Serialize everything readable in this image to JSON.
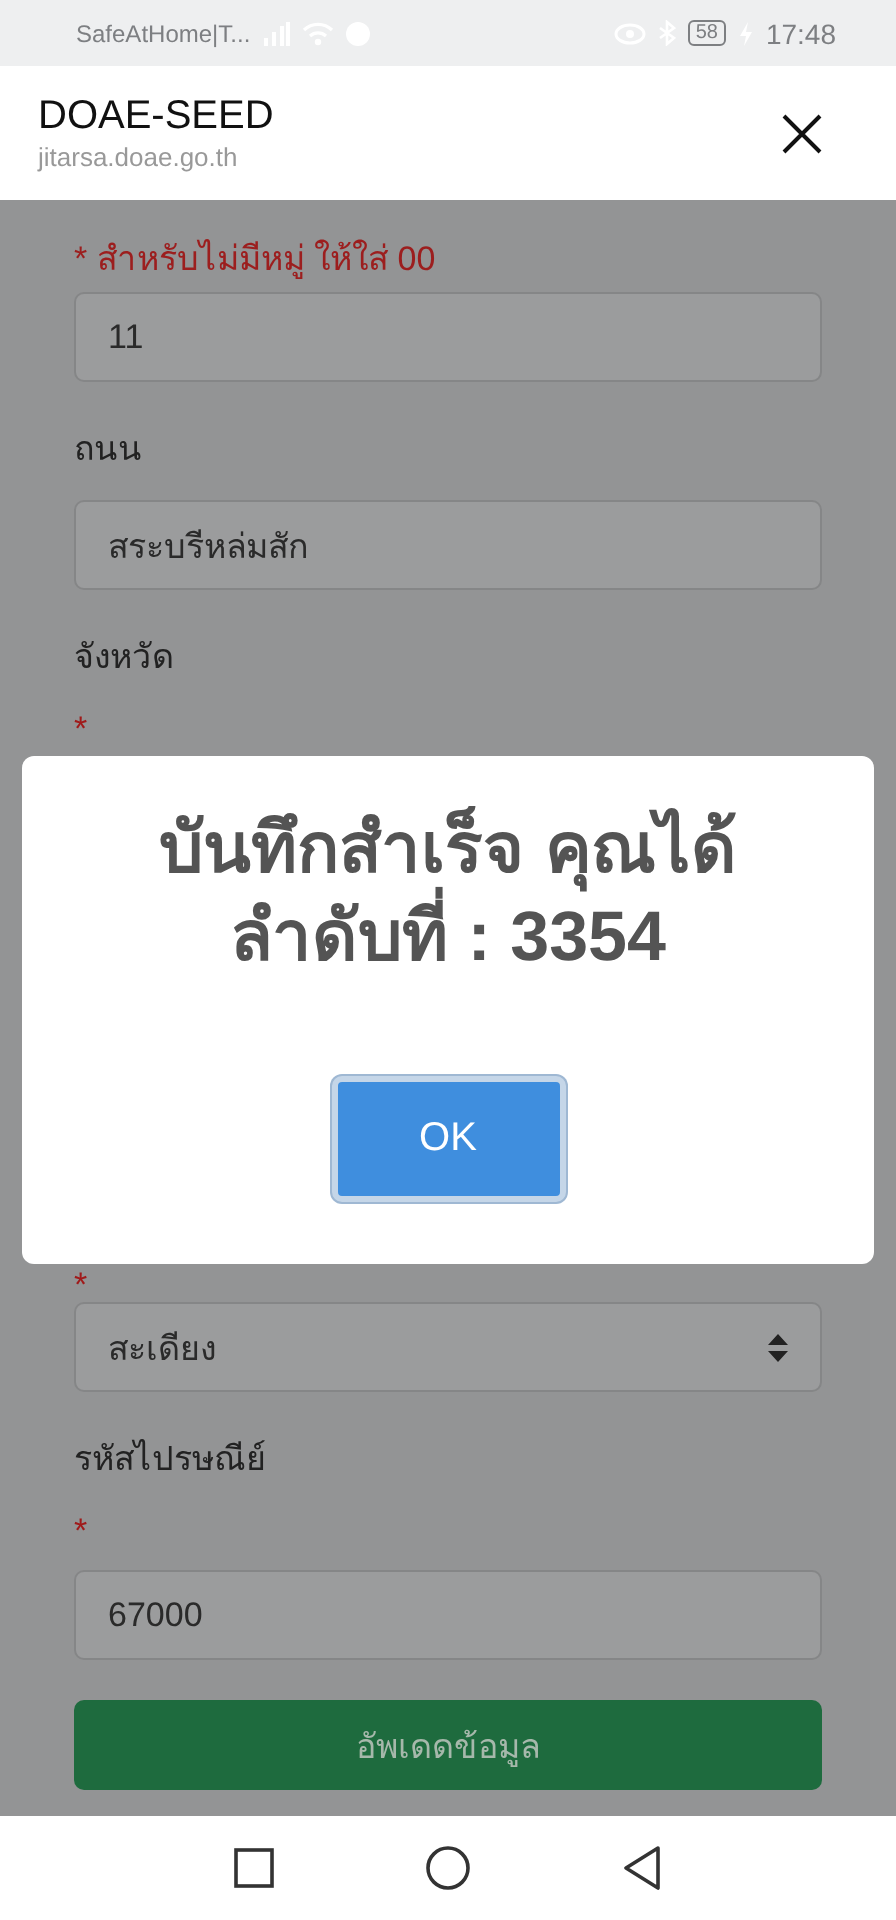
{
  "status_bar": {
    "carrier": "SafeAtHome|T...",
    "battery": "58",
    "time": "17:48"
  },
  "header": {
    "title": "DOAE-SEED",
    "url": "jitarsa.doae.go.th"
  },
  "form": {
    "fields": [
      {
        "kind": "input",
        "note": "* สำหรับไม่มีหมู่ ให้ใส่ 00",
        "value": "11"
      },
      {
        "kind": "input",
        "label": "ถนน",
        "value": "สระบรีหล่มสัก"
      },
      {
        "kind": "label",
        "label": "จังหวัด",
        "mark": "*"
      },
      {
        "kind": "select",
        "mark": "*",
        "value": "สะเดียง"
      },
      {
        "kind": "input",
        "label": "รหัสไปรษณีย์",
        "mark": "*",
        "value": "67000"
      }
    ],
    "submit": "อัพเดดข้อมูล"
  },
  "dialog": {
    "lines": [
      "บันทึกสำเร็จ คุณได้",
      "ลำดับที่ : 3354"
    ],
    "button": "OK"
  }
}
